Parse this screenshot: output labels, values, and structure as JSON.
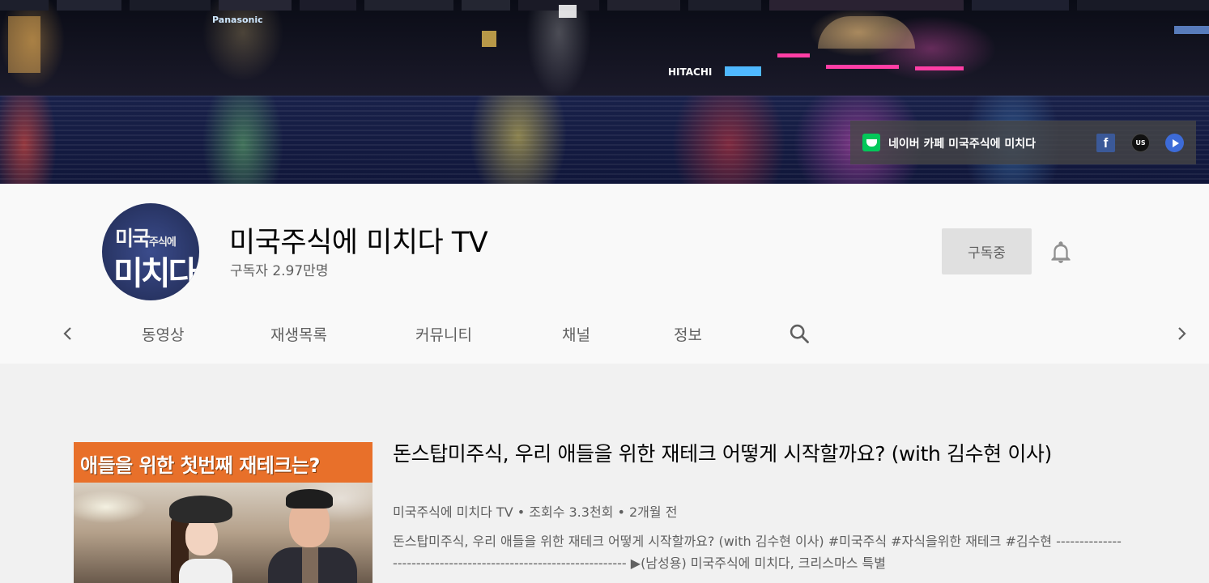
{
  "banner": {
    "city_signs": [
      "Panasonic",
      "HITACHI"
    ],
    "cafe_link": "네이버 카페 미국주식에 미치다",
    "social": [
      "facebook-icon",
      "us-stock-icon",
      "play-icon"
    ]
  },
  "channel": {
    "avatar_text_top": "미국",
    "avatar_text_top_small": "주식에",
    "avatar_text_bottom": "미치다",
    "name": "미국주식에 미치다 TV",
    "subscribers": "구독자 2.97만명",
    "subscribe_button": "구독중",
    "accent_color": "#065fd4"
  },
  "tabs": [
    "동영상",
    "재생목록",
    "커뮤니티",
    "채널",
    "정보"
  ],
  "featured": {
    "thumbnail_text": "애들을 위한 첫번째 재테크는?",
    "title": "돈스탑미주식, 우리 애들을 위한 재테크 어떻게 시작할까요? (with 김수현 이사)",
    "meta": "미국주식에 미치다 TV • 조회수 3.3천회 • 2개월 전",
    "description": "돈스탑미주식, 우리 애들을 위한 재테크 어떻게 시작할까요? (with 김수현 이사) #미국주식 #자식을위한 재테크 #김수현 ---------------------------------------------------------------- ▶(남성용) 미국주식에 미치다, 크리스마스 특별"
  }
}
